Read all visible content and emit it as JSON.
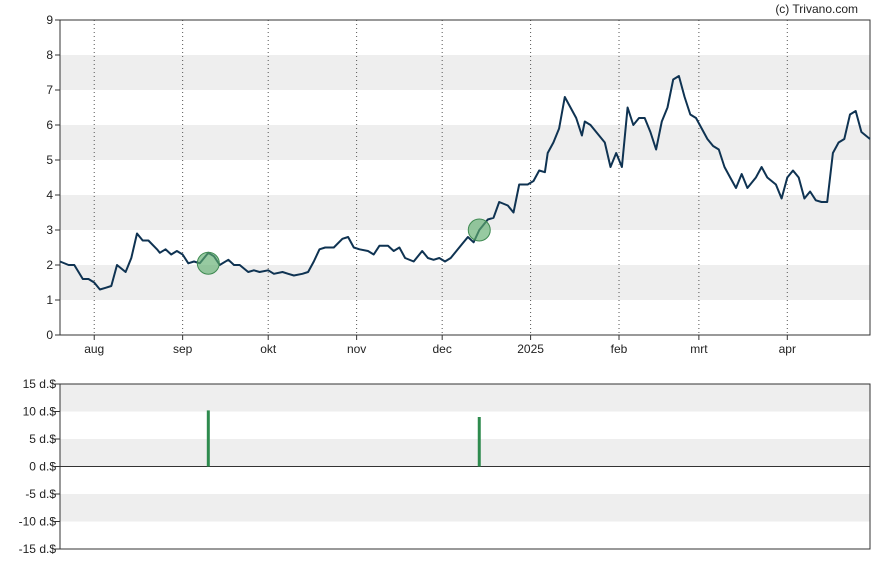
{
  "credit": "(c) Trivano.com",
  "colors": {
    "price_line": "#0f3352",
    "band": "#eeeeee",
    "marker_fill": "#5fae6f",
    "volume_bar": "#2e8b4e",
    "frame": "#333333"
  },
  "chart_data": [
    {
      "type": "line",
      "title": "",
      "xlabel": "",
      "ylabel": "",
      "ylim": [
        0,
        9
      ],
      "yticks": [
        "0",
        "1",
        "2",
        "3",
        "4",
        "5",
        "6",
        "7",
        "8",
        "9"
      ],
      "xlim": [
        "2024-07-20",
        "2025-04-30"
      ],
      "xticks": [
        {
          "date": "2024-08-01",
          "label": "aug"
        },
        {
          "date": "2024-09-01",
          "label": "sep"
        },
        {
          "date": "2024-10-01",
          "label": "okt"
        },
        {
          "date": "2024-11-01",
          "label": "nov"
        },
        {
          "date": "2024-12-01",
          "label": "dec"
        },
        {
          "date": "2025-01-01",
          "label": "2025"
        },
        {
          "date": "2025-02-01",
          "label": "feb"
        },
        {
          "date": "2025-03-01",
          "label": "mrt"
        },
        {
          "date": "2025-04-01",
          "label": "apr"
        }
      ],
      "grid": "dotted vertical lines at month ticks; alternating horizontal bands",
      "series": [
        {
          "x": [
            "2024-07-20",
            "2024-07-23",
            "2024-07-25",
            "2024-07-28",
            "2024-07-30",
            "2024-08-01",
            "2024-08-03",
            "2024-08-05",
            "2024-08-07",
            "2024-08-09",
            "2024-08-12",
            "2024-08-14",
            "2024-08-16",
            "2024-08-18",
            "2024-08-20",
            "2024-08-23",
            "2024-08-24",
            "2024-08-26",
            "2024-08-28",
            "2024-08-30",
            "2024-09-01",
            "2024-09-03",
            "2024-09-05",
            "2024-09-07",
            "2024-09-10",
            "2024-09-12",
            "2024-09-14",
            "2024-09-17",
            "2024-09-19",
            "2024-09-21",
            "2024-09-24",
            "2024-09-26",
            "2024-09-28",
            "2024-10-01",
            "2024-10-03",
            "2024-10-06",
            "2024-10-08",
            "2024-10-10",
            "2024-10-13",
            "2024-10-15",
            "2024-10-17",
            "2024-10-19",
            "2024-10-21",
            "2024-10-24",
            "2024-10-27",
            "2024-10-29",
            "2024-10-31",
            "2024-11-02",
            "2024-11-05",
            "2024-11-07",
            "2024-11-09",
            "2024-11-12",
            "2024-11-14",
            "2024-11-16",
            "2024-11-18",
            "2024-11-21",
            "2024-11-24",
            "2024-11-26",
            "2024-11-28",
            "2024-11-30",
            "2024-12-02",
            "2024-12-04",
            "2024-12-06",
            "2024-12-08",
            "2024-12-10",
            "2024-12-12",
            "2024-12-14",
            "2024-12-17",
            "2024-12-19",
            "2024-12-21",
            "2024-12-24",
            "2024-12-26",
            "2024-12-28",
            "2024-12-31",
            "2025-01-02",
            "2025-01-04",
            "2025-01-06",
            "2025-01-07",
            "2025-01-09",
            "2025-01-11",
            "2025-01-13",
            "2025-01-15",
            "2025-01-17",
            "2025-01-19",
            "2025-01-20",
            "2025-01-22",
            "2025-01-24",
            "2025-01-27",
            "2025-01-29",
            "2025-01-31",
            "2025-02-02",
            "2025-02-04",
            "2025-02-06",
            "2025-02-08",
            "2025-02-10",
            "2025-02-12",
            "2025-02-14",
            "2025-02-16",
            "2025-02-18",
            "2025-02-20",
            "2025-02-22",
            "2025-02-24",
            "2025-02-26",
            "2025-02-28",
            "2025-03-02",
            "2025-03-04",
            "2025-03-06",
            "2025-03-08",
            "2025-03-10",
            "2025-03-12",
            "2025-03-14",
            "2025-03-16",
            "2025-03-18",
            "2025-03-21",
            "2025-03-23",
            "2025-03-25",
            "2025-03-28",
            "2025-03-30",
            "2025-04-01",
            "2025-04-03",
            "2025-04-05",
            "2025-04-07",
            "2025-04-09",
            "2025-04-11",
            "2025-04-13",
            "2025-04-15",
            "2025-04-17",
            "2025-04-19",
            "2025-04-21",
            "2025-04-23",
            "2025-04-25",
            "2025-04-27",
            "2025-04-30"
          ],
          "y": [
            2.1,
            2.0,
            2.0,
            1.6,
            1.6,
            1.5,
            1.3,
            1.35,
            1.4,
            2.0,
            1.8,
            2.2,
            2.9,
            2.7,
            2.7,
            2.45,
            2.35,
            2.45,
            2.3,
            2.4,
            2.3,
            2.05,
            2.1,
            2.05,
            2.35,
            2.25,
            2.0,
            2.15,
            2.0,
            2.0,
            1.8,
            1.85,
            1.8,
            1.85,
            1.75,
            1.8,
            1.75,
            1.7,
            1.75,
            1.8,
            2.1,
            2.45,
            2.5,
            2.5,
            2.75,
            2.8,
            2.5,
            2.45,
            2.4,
            2.3,
            2.55,
            2.55,
            2.4,
            2.5,
            2.2,
            2.1,
            2.4,
            2.2,
            2.15,
            2.2,
            2.1,
            2.2,
            2.4,
            2.6,
            2.8,
            2.65,
            3.0,
            3.3,
            3.35,
            3.8,
            3.7,
            3.5,
            4.3,
            4.3,
            4.4,
            4.7,
            4.65,
            5.2,
            5.5,
            5.9,
            6.8,
            6.5,
            6.2,
            5.7,
            6.1,
            6.0,
            5.8,
            5.5,
            4.8,
            5.2,
            4.8,
            6.5,
            6.0,
            6.2,
            6.2,
            5.8,
            5.3,
            6.1,
            6.5,
            7.3,
            7.4,
            6.8,
            6.3,
            6.2,
            5.9,
            5.6,
            5.4,
            5.3,
            4.8,
            4.5,
            4.2,
            4.6,
            4.2,
            4.5,
            4.8,
            4.5,
            4.3,
            3.9,
            4.5,
            4.7,
            4.5,
            3.9,
            4.1,
            3.85,
            3.8,
            3.8,
            5.2,
            5.5,
            5.6,
            6.3,
            6.4,
            5.8,
            5.6
          ]
        }
      ],
      "markers": [
        {
          "date": "2024-09-10",
          "value": 2.05
        },
        {
          "date": "2024-12-14",
          "value": 3.0
        }
      ]
    },
    {
      "type": "bar",
      "title": "",
      "xlabel": "",
      "ylabel": "",
      "ylim": [
        -15,
        15
      ],
      "yticks": [
        "15 d.$",
        "10 d.$",
        "5 d.$",
        "0 d.$",
        "-5 d.$",
        "-10 d.$",
        "-15 d.$"
      ],
      "xlim": [
        "2024-07-20",
        "2025-04-30"
      ],
      "bars": [
        {
          "date": "2024-09-10",
          "value": 10.2
        },
        {
          "date": "2024-12-14",
          "value": 9.0
        }
      ]
    }
  ]
}
